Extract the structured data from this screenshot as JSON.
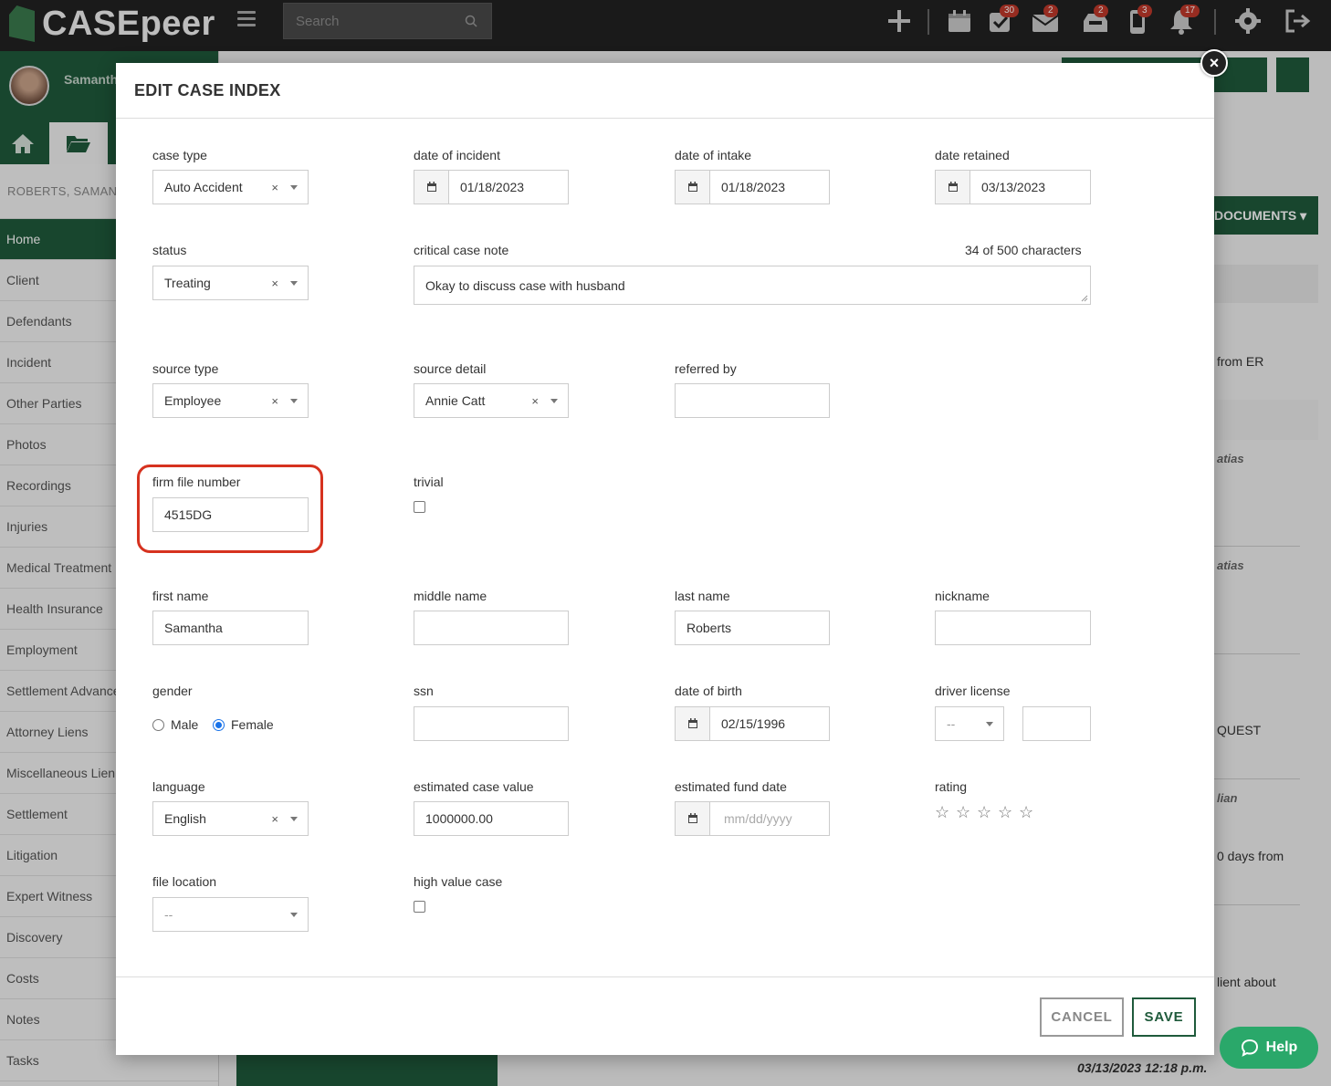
{
  "app": {
    "brand": "CASEpeer",
    "search_placeholder": "Search",
    "badges": {
      "calendar": "30",
      "tasks": "2",
      "mail": "2",
      "inbox": "3",
      "phone": "17"
    },
    "user_name": "Samanth",
    "case_label": "ROBERTS, SAMAN"
  },
  "sidebar": {
    "items": [
      {
        "label": "Home"
      },
      {
        "label": "Client"
      },
      {
        "label": "Defendants"
      },
      {
        "label": "Incident"
      },
      {
        "label": "Other Parties"
      },
      {
        "label": "Photos"
      },
      {
        "label": "Recordings"
      },
      {
        "label": "Injuries"
      },
      {
        "label": "Medical Treatment"
      },
      {
        "label": "Health Insurance"
      },
      {
        "label": "Employment"
      },
      {
        "label": "Settlement Advance"
      },
      {
        "label": "Attorney Liens"
      },
      {
        "label": "Miscellaneous Lien"
      },
      {
        "label": "Settlement"
      },
      {
        "label": "Litigation"
      },
      {
        "label": "Expert Witness"
      },
      {
        "label": "Discovery"
      },
      {
        "label": "Costs"
      },
      {
        "label": "Notes"
      },
      {
        "label": "Tasks"
      }
    ]
  },
  "background": {
    "documents_button": "DOCUMENTS",
    "peek": [
      "from ER",
      "atias",
      "atias",
      "QUEST",
      "lian",
      "0 days from",
      "lient about"
    ],
    "timestamp": "03/13/2023 12:18 p.m.",
    "help": "Help"
  },
  "modal": {
    "title": "EDIT CASE INDEX",
    "case_type": {
      "label": "case type",
      "value": "Auto Accident"
    },
    "date_of_incident": {
      "label": "date of incident",
      "value": "01/18/2023"
    },
    "date_of_intake": {
      "label": "date of intake",
      "value": "01/18/2023"
    },
    "date_retained": {
      "label": "date retained",
      "value": "03/13/2023"
    },
    "status": {
      "label": "status",
      "value": "Treating"
    },
    "critical_case_note": {
      "label": "critical case note",
      "value": "Okay to discuss case with husband",
      "counter": "34 of 500 characters"
    },
    "source_type": {
      "label": "source type",
      "value": "Employee"
    },
    "source_detail": {
      "label": "source detail",
      "value": "Annie Catt"
    },
    "referred_by": {
      "label": "referred by",
      "value": ""
    },
    "firm_file_number": {
      "label": "firm file number",
      "value": "4515DG"
    },
    "trivial": {
      "label": "trivial",
      "checked": false
    },
    "first_name": {
      "label": "first name",
      "value": "Samantha"
    },
    "middle_name": {
      "label": "middle name",
      "value": ""
    },
    "last_name": {
      "label": "last name",
      "value": "Roberts"
    },
    "nickname": {
      "label": "nickname",
      "value": ""
    },
    "gender": {
      "label": "gender",
      "options": [
        "Male",
        "Female"
      ],
      "selected": "Female"
    },
    "ssn": {
      "label": "ssn",
      "value": ""
    },
    "date_of_birth": {
      "label": "date of birth",
      "value": "02/15/1996"
    },
    "driver_license": {
      "label": "driver license",
      "state": "--",
      "value": ""
    },
    "language": {
      "label": "language",
      "value": "English"
    },
    "estimated_case_value": {
      "label": "estimated case value",
      "value": "1000000.00"
    },
    "estimated_fund_date": {
      "label": "estimated fund date",
      "placeholder": "mm/dd/yyyy"
    },
    "rating": {
      "label": "rating",
      "stars": 5,
      "value": 0
    },
    "file_location": {
      "label": "file location",
      "value": "--"
    },
    "high_value_case": {
      "label": "high value case",
      "checked": false
    },
    "cancel": "CANCEL",
    "save": "SAVE"
  }
}
